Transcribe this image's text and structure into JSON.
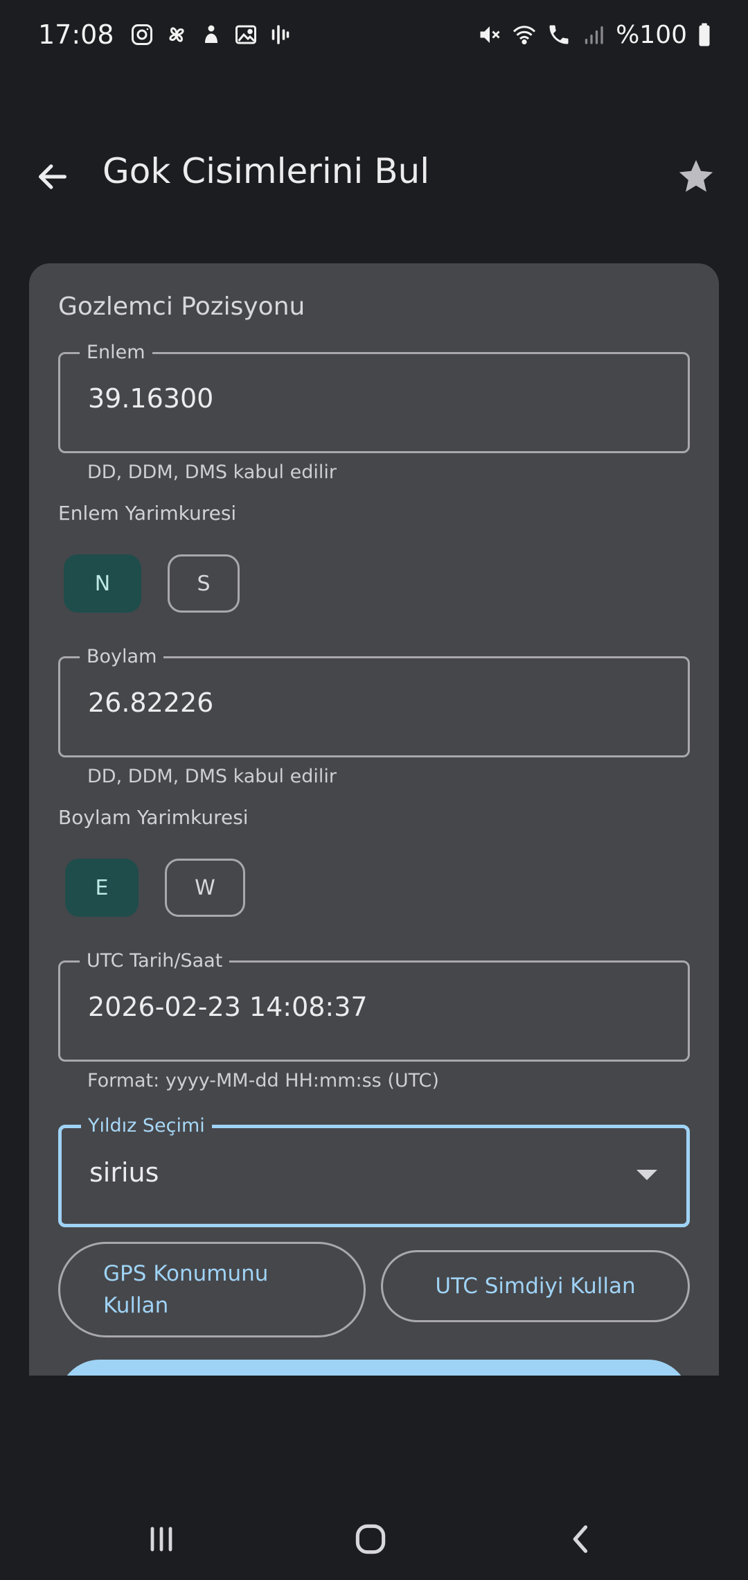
{
  "status_bar": {
    "time": "17:08",
    "battery": "%100",
    "icons_left": [
      "instagram-icon",
      "pinwheel-icon",
      "figure-icon",
      "gallery-icon",
      "voice-icon"
    ],
    "icons_right": [
      "mute-icon",
      "wifi-call-icon",
      "call-icon",
      "signal-icon",
      "battery-icon"
    ]
  },
  "app_bar": {
    "title": "Gok Cisimlerini Bul",
    "back_icon": "arrow-back-icon",
    "star_icon": "star-icon"
  },
  "card": {
    "section_title": "Gozlemci Pozisyonu",
    "latitude": {
      "label": "Enlem",
      "value": "39.16300",
      "helper": "DD, DDM, DMS kabul edilir"
    },
    "latitude_hemisphere": {
      "label": "Enlem Yarimkuresi",
      "options": [
        "N",
        "S"
      ],
      "selected": "N"
    },
    "longitude": {
      "label": "Boylam",
      "value": "26.82226",
      "helper": "DD, DDM, DMS kabul edilir"
    },
    "longitude_hemisphere": {
      "label": "Boylam Yarimkuresi",
      "options": [
        "E",
        "W"
      ],
      "selected": "E"
    },
    "utc": {
      "label": "UTC Tarih/Saat",
      "value": "2026-02-23 14:08:37",
      "helper": "Format: yyyy-MM-dd HH:mm:ss (UTC)"
    },
    "star_select": {
      "label": "Yıldız Seçimi",
      "value": "sirius"
    },
    "gps_button": {
      "line1": "GPS Konumunu",
      "line2": "Kullan"
    },
    "utc_now_button": "UTC Simdiyi Kullan"
  },
  "colors": {
    "background": "#1c1d20",
    "card": "#46474b",
    "accent": "#9fd3f5",
    "chip_selected": "#1f4d4b"
  }
}
